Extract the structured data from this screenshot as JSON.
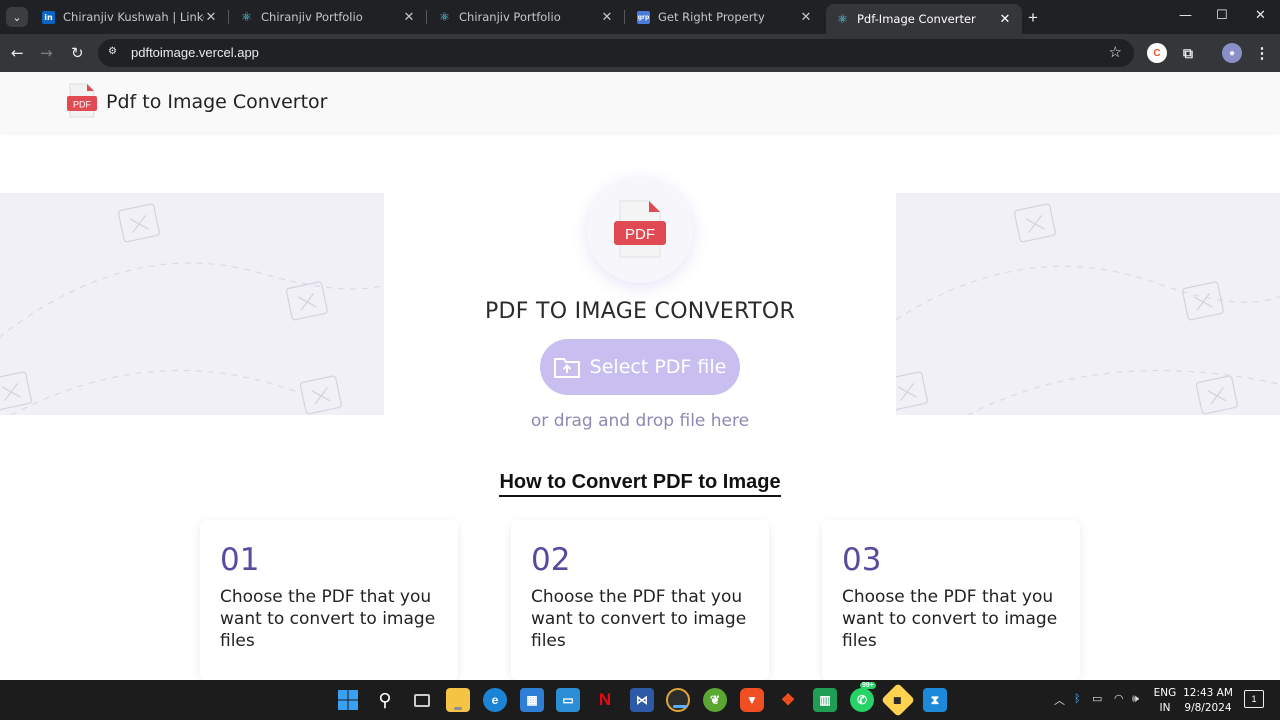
{
  "browser": {
    "tabs": [
      {
        "label": "Chiranjiv Kushwah | LinkedIn",
        "favicon": "linkedin-icon",
        "color": "#0a66c2"
      },
      {
        "label": "Chiranjiv Portfolio",
        "favicon": "react-icon",
        "color": "#61dafb"
      },
      {
        "label": "Chiranjiv Portfolio",
        "favicon": "react-icon",
        "color": "#61dafb"
      },
      {
        "label": "Get Right Property",
        "favicon": "grp-icon",
        "color": "#4a7bd8"
      },
      {
        "label": "Pdf-Image Converter",
        "favicon": "react-icon",
        "color": "#61dafb",
        "active": true
      }
    ],
    "url": "pdftoimage.vercel.app"
  },
  "site": {
    "brand_title": "Pdf to Image Convertor",
    "pdf_badge": "PDF",
    "hero_title": "PDF TO IMAGE CONVERTOR",
    "select_button": "Select PDF file",
    "drag_text": "or drag and drop file here",
    "how_title": "How to Convert PDF to Image",
    "steps": [
      {
        "num": "01",
        "text": "Choose the PDF that you want to convert to image files"
      },
      {
        "num": "02",
        "text": "Choose the PDF that you want to convert to image files"
      },
      {
        "num": "03",
        "text": "Choose the PDF that you want to convert to image files"
      }
    ],
    "colors": {
      "accent": "#c8bff0",
      "step_number": "#5a4a9e",
      "pdf_red": "#e04a52",
      "panel_bg": "#f1f0f7"
    }
  },
  "taskbar": {
    "whatsapp_badge": "99+",
    "lang_line1": "ENG",
    "lang_line2": "IN",
    "time": "12:43 AM",
    "date": "9/8/2024",
    "notif_count": "1"
  }
}
